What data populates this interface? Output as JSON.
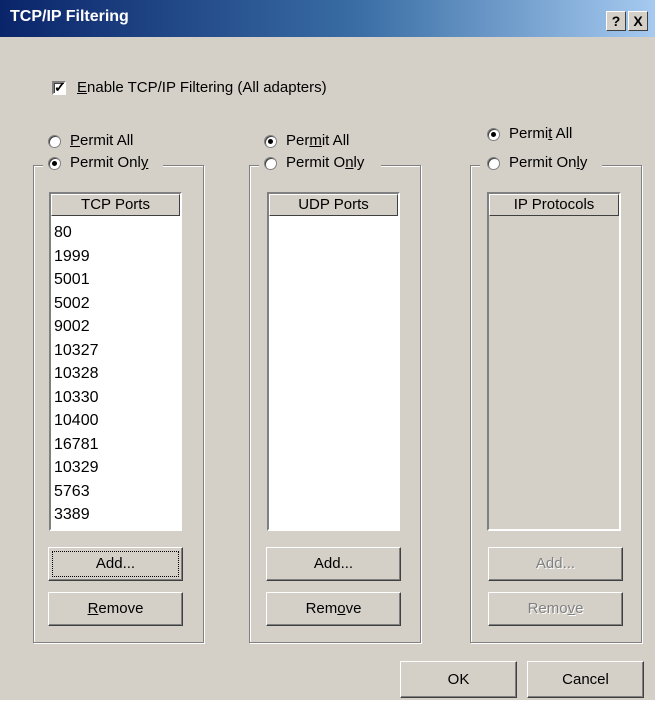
{
  "window": {
    "title": "TCP/IP Filtering",
    "help_glyph": "?",
    "close_glyph": "X"
  },
  "enable_filtering": {
    "checked": true,
    "label_access": "E",
    "label_rest": "nable TCP/IP Filtering (All adapters)"
  },
  "tcp": {
    "permit_all": {
      "pre": "",
      "access": "P",
      "post": "ermit All",
      "selected": false
    },
    "permit_only": {
      "pre": "Permit Onl",
      "access": "y",
      "post": "",
      "selected": true
    },
    "list_header": "TCP Ports",
    "items": [
      "80",
      "1999",
      "5001",
      "5002",
      "9002",
      "10327",
      "10328",
      "10330",
      "10400",
      "16781",
      "10329",
      "5763",
      "3389"
    ],
    "add": {
      "pre": "Add...",
      "access": "",
      "post": ""
    },
    "remove": {
      "pre": "",
      "access": "R",
      "post": "emove"
    }
  },
  "udp": {
    "permit_all": {
      "pre": "Per",
      "access": "m",
      "post": "it All",
      "selected": true
    },
    "permit_only": {
      "pre": "Permit O",
      "access": "n",
      "post": "ly",
      "selected": false
    },
    "list_header": "UDP Ports",
    "items": [],
    "add": {
      "pre": "Add...",
      "access": "",
      "post": ""
    },
    "remove": {
      "pre": "Rem",
      "access": "o",
      "post": "ve"
    }
  },
  "ip": {
    "permit_all": {
      "pre": "Permi",
      "access": "t",
      "post": " All",
      "selected": true
    },
    "permit_only": {
      "pre": "Permit On",
      "access": "l",
      "post": "y",
      "selected": false
    },
    "list_header": "IP Protocols",
    "items": [],
    "add": {
      "pre": "Add...",
      "access": "",
      "post": ""
    },
    "remove": {
      "pre": "Remo",
      "access": "v",
      "post": "e"
    }
  },
  "footer": {
    "ok": "OK",
    "cancel": "Cancel"
  }
}
